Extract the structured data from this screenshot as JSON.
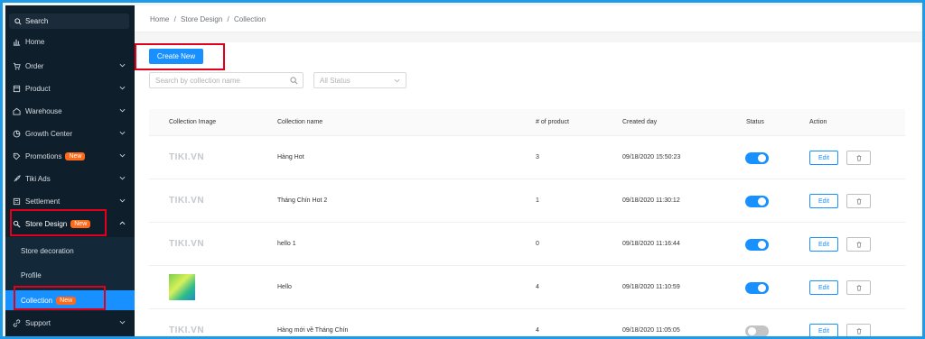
{
  "sidebar": {
    "search_label": "Search",
    "items": [
      {
        "label": "Home"
      },
      {
        "label": "Order"
      },
      {
        "label": "Product"
      },
      {
        "label": "Warehouse"
      },
      {
        "label": "Growth Center"
      },
      {
        "label": "Promotions",
        "badge": "New"
      },
      {
        "label": "Tiki Ads"
      },
      {
        "label": "Settlement"
      },
      {
        "label": "Store Design",
        "badge": "New"
      },
      {
        "label": "Support"
      }
    ],
    "sub_items": [
      {
        "label": "Store decoration"
      },
      {
        "label": "Profile"
      },
      {
        "label": "Collection",
        "badge": "New"
      }
    ]
  },
  "breadcrumb": {
    "home": "Home",
    "sep": "/",
    "store_design": "Store Design",
    "current": "Collection"
  },
  "toolbar": {
    "create_label": "Create New",
    "search_placeholder": "Search by collection name",
    "status_select": "All Status"
  },
  "table": {
    "headers": [
      "Collection Image",
      "Collection name",
      "# of product",
      "Created day",
      "Status",
      "Action"
    ],
    "rows": [
      {
        "image": "TIKI.VN",
        "name": "Hàng Hot",
        "count": "3",
        "created": "09/18/2020 15:50:23",
        "status": true
      },
      {
        "image": "TIKI.VN",
        "name": "Tháng Chín Hot 2",
        "count": "1",
        "created": "09/18/2020 11:30:12",
        "status": true
      },
      {
        "image": "TIKI.VN",
        "name": "hello 1",
        "count": "0",
        "created": "09/18/2020 11:16:44",
        "status": true
      },
      {
        "image": "",
        "name": "Hello",
        "count": "4",
        "created": "09/18/2020 11:10:59",
        "status": true
      },
      {
        "image": "TIKI.VN",
        "name": "Hàng mới về Tháng Chín",
        "count": "4",
        "created": "09/18/2020 11:05:05",
        "status": false
      }
    ],
    "edit_label": "Edit"
  },
  "colors": {
    "accent": "#1890ff",
    "sidebar_bg": "#0e1e2b",
    "badge": "#ff6a1a",
    "highlight": "#e0001b",
    "frame": "#1e9be8"
  }
}
